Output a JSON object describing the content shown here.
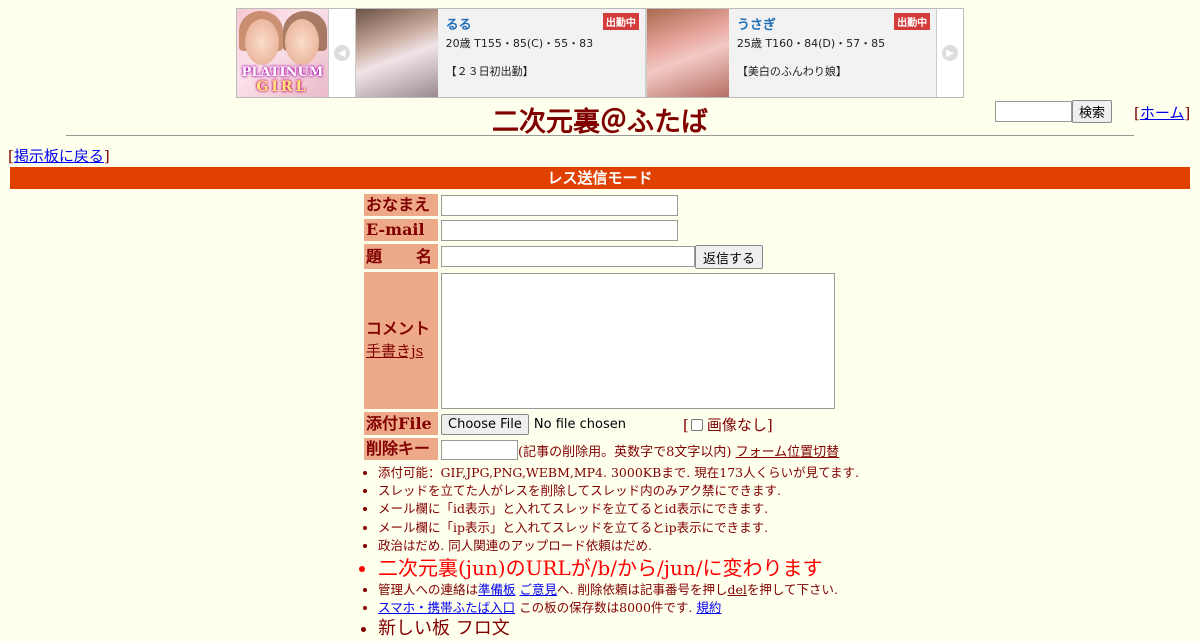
{
  "banner": {
    "logo_line1": "PLATINUM",
    "logo_line2": "GIRL",
    "cards": [
      {
        "name": "るる",
        "badge": "出勤中",
        "spec": "20歳 T155・85(C)・55・83",
        "note": "【２３日初出勤】"
      },
      {
        "name": "うさぎ",
        "badge": "出勤中",
        "spec": "25歳 T160・84(D)・57・85",
        "note": "【美白のふんわり娘】"
      }
    ]
  },
  "header": {
    "title": "二次元裏＠ふたば",
    "search_button": "検索",
    "home_open": "[",
    "home_label": "ホーム",
    "home_close": "]"
  },
  "nav": {
    "back_open": "[",
    "back_label": "掲示板に戻る",
    "back_close": "]"
  },
  "mode_bar": "レス送信モード",
  "form": {
    "name_label": "おなまえ",
    "email_label": "E-mail",
    "subject_label_1": "題",
    "subject_label_2": "名",
    "submit_label": "返信する",
    "comment_label": "コメント",
    "handwrite_label": "手書きjs",
    "file_label": "添付File",
    "choose_file": "Choose File",
    "no_file": "No file chosen",
    "no_image_open": "[",
    "no_image_label": "画像なし",
    "no_image_close": "]",
    "delkey_label": "削除キー",
    "delkey_note": "(記事の削除用。英数字で8文字以内)",
    "form_toggle": "フォーム位置切替"
  },
  "notes": {
    "n1": "添付可能：GIF,JPG,PNG,WEBM,MP4. 3000KBまで. 現在173人くらいが見てます.",
    "n2": "スレッドを立てた人がレスを削除してスレッド内のみアク禁にできます.",
    "n3": "メール欄に「id表示」と入れてスレッドを立てるとid表示にできます.",
    "n4": "メール欄に「ip表示」と入れてスレッドを立てるとip表示にできます.",
    "n5": "政治はだめ. 同人関連のアップロード依頼はだめ.",
    "n6": "二次元裏(jun)のURLが/b/から/jun/に変わります",
    "n7_pre": "管理人への連絡は",
    "n7_link1": "準備板",
    "n7_link2": "ご意見",
    "n7_mid": "へ. 削除依頼は記事番号を押し",
    "n7_link3": "del",
    "n7_post": "を押して下さい.",
    "n8_link": "スマホ・携帯ふたば入口",
    "n8_mid": " この板の保存数は8000件です. ",
    "n8_link2": "規約",
    "n9": "新しい板 フロ文"
  }
}
